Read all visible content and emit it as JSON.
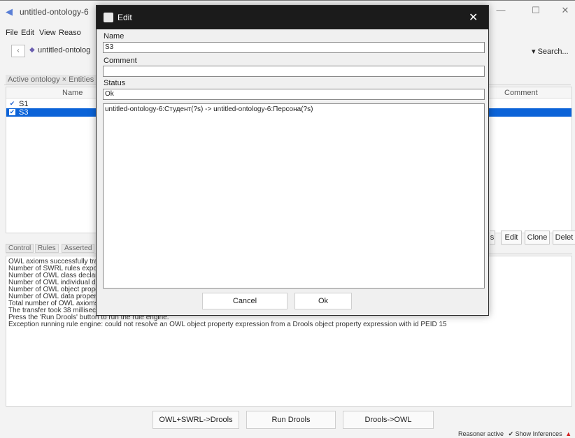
{
  "window": {
    "title": "untitled-ontology-6",
    "minimize": "—",
    "maximize": "☐",
    "close": "✕"
  },
  "menubar": [
    "File",
    "Edit",
    "View",
    "Reaso"
  ],
  "nav": {
    "back": "‹",
    "ontology": "untitled-ontolog",
    "search": "▾ Search..."
  },
  "tabs": {
    "active": "Active ontology × Entities"
  },
  "rules_table": {
    "columns": [
      "Name",
      "Comment"
    ],
    "rows": [
      {
        "checked": true,
        "name": "S1"
      },
      {
        "checked": true,
        "name": "S3"
      }
    ]
  },
  "table_buttons": [
    "Edit",
    "Clone",
    "Delet"
  ],
  "lower_tabs": [
    "Control",
    "Rules",
    "Asserted"
  ],
  "console_lines": [
    "OWL axioms successfully tra",
    "Number of SWRL rules expor",
    "Number of OWL class declar",
    "Number of OWL individual de",
    "Number of OWL object prope",
    "Number of OWL data propert",
    "Total number of OWL axioms exported to rule engine: 263",
    "The transfer took 38 millisecond(s).",
    "Press the 'Run Drools' button to run the rule engine.",
    "Exception running rule engine: could not resolve an OWL object property expression from a Drools object property expression with id PEID 15"
  ],
  "bottom_buttons": [
    "OWL+SWRL->Drools",
    "Run Drools",
    "Drools->OWL"
  ],
  "status": {
    "text": "Reasoner active",
    "show_inferences": "Show Inferences"
  },
  "dialog": {
    "title": "Edit",
    "close": "✕",
    "name_label": "Name",
    "name_value": "S3",
    "comment_label": "Comment",
    "comment_value": "",
    "status_label": "Status",
    "status_value": "Ok",
    "rule_text": "untitled-ontology-6:Студент(?s) -> untitled-ontology-6:Персона(?s)",
    "cancel": "Cancel",
    "ok": "Ok"
  }
}
